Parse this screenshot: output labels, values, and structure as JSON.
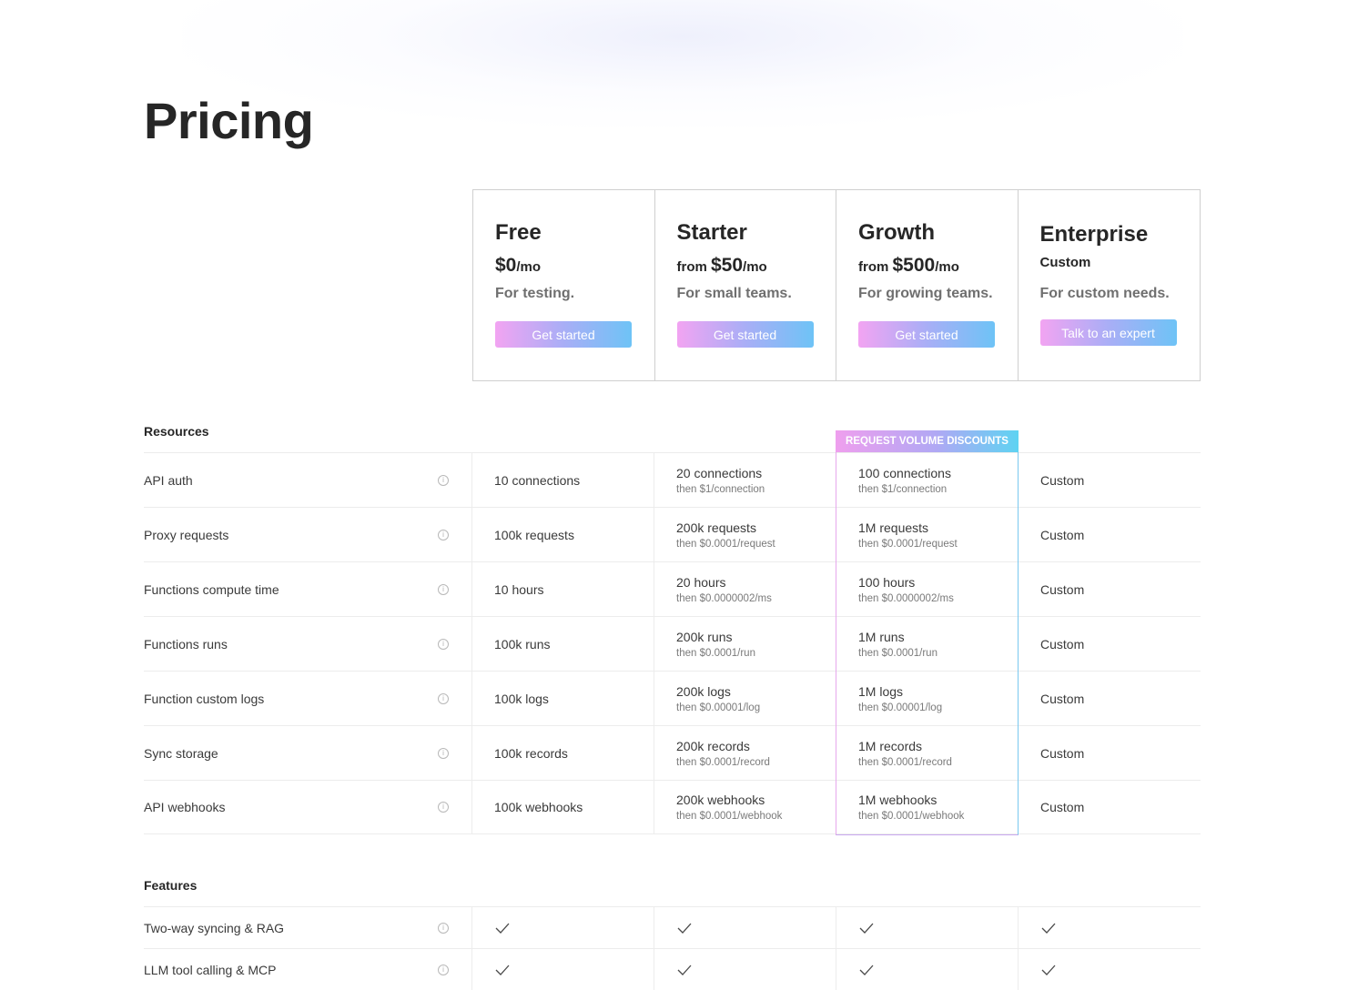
{
  "page": {
    "title": "Pricing"
  },
  "plans": [
    {
      "name": "Free",
      "price_prefix": "",
      "price": "$0",
      "price_suffix": "/mo",
      "desc": "For testing.",
      "cta": "Get started"
    },
    {
      "name": "Starter",
      "price_prefix": "from ",
      "price": "$50",
      "price_suffix": "/mo",
      "desc": "For small teams.",
      "cta": "Get started"
    },
    {
      "name": "Growth",
      "price_prefix": "from ",
      "price": "$500",
      "price_suffix": "/mo",
      "desc": "For growing teams.",
      "cta": "Get started"
    },
    {
      "name": "Enterprise",
      "price_text": "Custom",
      "desc": "For custom needs.",
      "cta": "Talk to an expert"
    }
  ],
  "resources": {
    "title": "Resources",
    "badge": "REQUEST VOLUME DISCOUNTS",
    "rows": [
      {
        "label": "API auth",
        "free": "10 connections",
        "starter": "20 connections",
        "starter_sub": "then $1/connection",
        "growth": "100 connections",
        "growth_sub": "then $1/connection",
        "enterprise": "Custom"
      },
      {
        "label": "Proxy requests",
        "free": "100k requests",
        "starter": "200k requests",
        "starter_sub": "then $0.0001/request",
        "growth": "1M requests",
        "growth_sub": "then $0.0001/request",
        "enterprise": "Custom"
      },
      {
        "label": "Functions compute time",
        "free": "10 hours",
        "starter": "20 hours",
        "starter_sub": "then $0.0000002/ms",
        "growth": "100 hours",
        "growth_sub": "then $0.0000002/ms",
        "enterprise": "Custom"
      },
      {
        "label": "Functions runs",
        "free": "100k runs",
        "starter": "200k runs",
        "starter_sub": "then $0.0001/run",
        "growth": "1M runs",
        "growth_sub": "then $0.0001/run",
        "enterprise": "Custom"
      },
      {
        "label": "Function custom logs",
        "free": "100k logs",
        "starter": "200k logs",
        "starter_sub": "then $0.00001/log",
        "growth": "1M logs",
        "growth_sub": "then $0.00001/log",
        "enterprise": "Custom"
      },
      {
        "label": "Sync storage",
        "free": "100k records",
        "starter": "200k records",
        "starter_sub": "then $0.0001/record",
        "growth": "1M records",
        "growth_sub": "then $0.0001/record",
        "enterprise": "Custom"
      },
      {
        "label": "API webhooks",
        "free": "100k webhooks",
        "starter": "200k webhooks",
        "starter_sub": "then $0.0001/webhook",
        "growth": "1M webhooks",
        "growth_sub": "then $0.0001/webhook",
        "enterprise": "Custom"
      }
    ]
  },
  "features": {
    "title": "Features",
    "rows": [
      {
        "label": "Two-way syncing & RAG"
      },
      {
        "label": "LLM tool calling & MCP"
      }
    ]
  },
  "icons": {
    "info": "info-icon",
    "check": "check-icon"
  },
  "colors": {
    "gradient_start": "#f2a4f2",
    "gradient_end": "#6ec3f6"
  }
}
